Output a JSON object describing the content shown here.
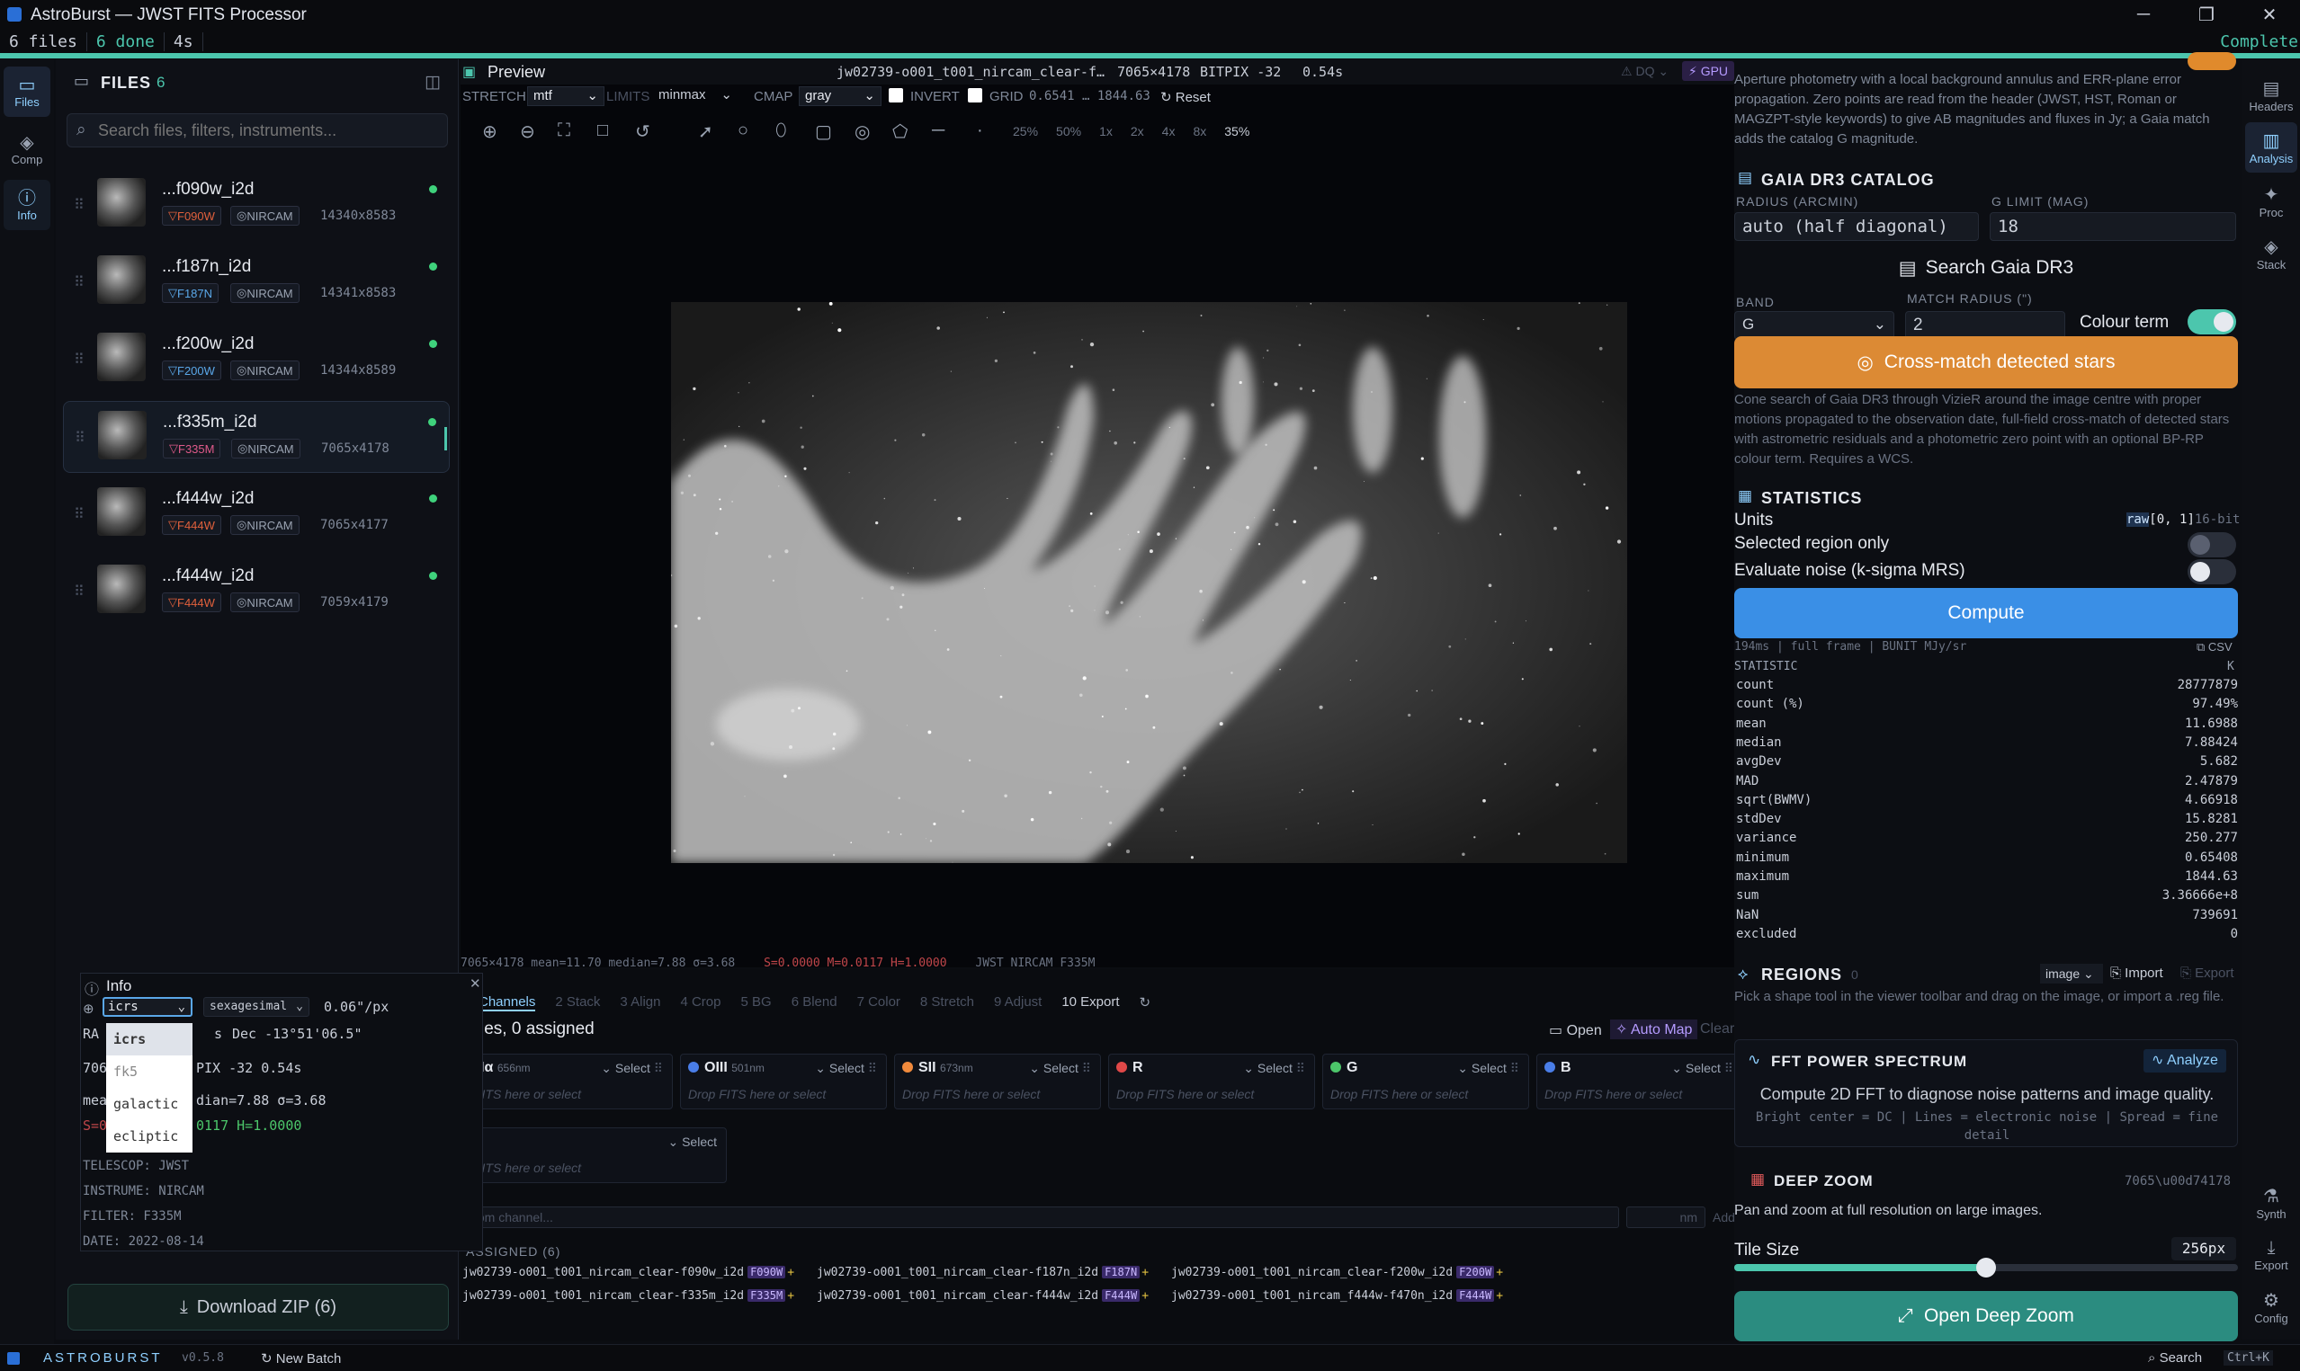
{
  "window": {
    "title": "AstroBurst — JWST FITS Processor",
    "minimize": "─",
    "maximize": "❐",
    "close": "✕"
  },
  "status": {
    "files": "6 files",
    "done": "6 done",
    "time": "4s",
    "state": "Complete"
  },
  "left_rail": [
    {
      "label": "Files",
      "icon": "folder-icon"
    },
    {
      "label": "Comp",
      "icon": "layers-icon"
    },
    {
      "label": "Info",
      "icon": "info-icon"
    }
  ],
  "files_panel": {
    "title": "FILES",
    "count": "6",
    "search_placeholder": "Search files, filters, instruments...",
    "items": [
      {
        "name": "...f090w_i2d",
        "filter": "F090W",
        "instrument": "NIRCAM",
        "dims": "14340x8583",
        "filter_color": "#e0603c"
      },
      {
        "name": "...f187n_i2d",
        "filter": "F187N",
        "instrument": "NIRCAM",
        "dims": "14341x8583",
        "filter_color": "#5aa7e8"
      },
      {
        "name": "...f200w_i2d",
        "filter": "F200W",
        "instrument": "NIRCAM",
        "dims": "14344x8589",
        "filter_color": "#5aa7e8"
      },
      {
        "name": "...f335m_i2d",
        "filter": "F335M",
        "instrument": "NIRCAM",
        "dims": "7065x4178",
        "filter_color": "#e05a8a"
      },
      {
        "name": "...f444w_i2d",
        "filter": "F444W",
        "instrument": "NIRCAM",
        "dims": "7065x4177",
        "filter_color": "#e0603c"
      },
      {
        "name": "...f444w_i2d",
        "filter": "F444W",
        "instrument": "NIRCAM",
        "dims": "7059x4179",
        "filter_color": "#e0603c"
      }
    ],
    "download": "Download ZIP (6)"
  },
  "preview": {
    "title": "Preview",
    "filename": "jw02739-o001_t001_nircam_clear-f…",
    "dims": "7065×4178",
    "bitpix": "BITPIX -32",
    "time": "0.54s",
    "dq": "DQ",
    "gpu": "GPU",
    "stretch_label": "STRETCH",
    "stretch": "mtf",
    "limits_label": "LIMITS",
    "limits": "minmax",
    "cmap_label": "CMAP",
    "cmap": "gray",
    "invert": "INVERT",
    "grid": "GRID",
    "range": "0.6541 … 1844.63",
    "reset": "Reset",
    "zooms": [
      "25%",
      "50%",
      "1x",
      "2x",
      "4x",
      "8x",
      "35%"
    ],
    "footer": "7065×4178  mean=11.70 median=7.88 σ=3.68",
    "footer_stf": "S=0.0000 M=0.0117 H=1.0000",
    "footer_inst": "JWST NIRCAM F335M"
  },
  "info_panel": {
    "title": "Info",
    "frame": "icrs",
    "format": "sexagesimal",
    "scale": "0.06\"/px",
    "ra_label": "RA",
    "ra_tail": "s",
    "dec": "Dec -13°51'06.5\"",
    "row2_a": "706",
    "row2_b": "PIX -32  0.54s",
    "row3_a": "mea",
    "row3_b": "dian=7.88  σ=3.68",
    "row4_a": "S=0",
    "row4_b": "0117  H=1.0000",
    "telescope": "TELESCOP: JWST",
    "instrument": "INSTRUME: NIRCAM",
    "filter": "FILTER: F335M",
    "date": "DATE: 2022-08-14",
    "menu": [
      "icrs",
      "fk5",
      "galactic",
      "ecliptic"
    ]
  },
  "pipeline_tabs": [
    "Channels",
    "2 Stack",
    "3 Align",
    "4 Crop",
    "5 BG",
    "6 Blend",
    "7 Color",
    "8 Stretch",
    "9 Adjust",
    "10 Export"
  ],
  "channels": {
    "assigned": "les, 0 assigned",
    "open": "Open",
    "automap": "Auto Map",
    "clear": "Clear",
    "select": "Select",
    "drop": "Drop FITS here or select",
    "drop_cut": "FITS here or select",
    "items": [
      {
        "name": "Hα",
        "nm": "656nm",
        "color": ""
      },
      {
        "name": "OIII",
        "nm": "501nm",
        "color": "#4a7ee8"
      },
      {
        "name": "SII",
        "nm": "673nm",
        "color": "#f08a3c"
      },
      {
        "name": "R",
        "nm": "",
        "color": "#e04848"
      },
      {
        "name": "G",
        "nm": "",
        "color": "#4cc66a"
      },
      {
        "name": "B",
        "nm": "",
        "color": "#4a7ee8"
      }
    ],
    "custom_placeholder": "tom channel...",
    "nm_placeholder": "nm",
    "add": "Add",
    "unassigned_title": "ASSIGNED (6)",
    "unassigned": [
      {
        "name": "jw02739-o001_t001_nircam_clear-f090w_i2d",
        "chip": "F090W"
      },
      {
        "name": "jw02739-o001_t001_nircam_clear-f187n_i2d",
        "chip": "F187N"
      },
      {
        "name": "jw02739-o001_t001_nircam_clear-f200w_i2d",
        "chip": "F200W"
      },
      {
        "name": "jw02739-o001_t001_nircam_clear-f335m_i2d",
        "chip": "F335M"
      },
      {
        "name": "jw02739-o001_t001_nircam_clear-f444w_i2d",
        "chip": "F444W"
      },
      {
        "name": "jw02739-o001_t001_nircam_f444w-f470n_i2d",
        "chip": "F444W"
      }
    ]
  },
  "photometry": {
    "desc": "Aperture photometry with a local background annulus and ERR-plane error propagation. Zero points are read from the header (JWST, HST, Roman or MAGZPT-style keywords) to give AB magnitudes and fluxes in Jy; a Gaia match adds the catalog G magnitude."
  },
  "gaia": {
    "title": "GAIA DR3 CATALOG",
    "radius_label": "RADIUS (ARCMIN)",
    "radius": "auto (half diagonal)",
    "glimit_label": "G LIMIT (MAG)",
    "glimit": "18",
    "search": "Search Gaia DR3",
    "band_label": "BAND",
    "band": "G",
    "match_label": "MATCH RADIUS (\")",
    "match": "2",
    "colour_term": "Colour term",
    "crossmatch": "Cross-match detected stars",
    "desc": "Cone search of Gaia DR3 through VizieR around the image centre with proper motions propagated to the observation date, full-field cross-match of detected stars with astrometric residuals and a photometric zero point with an optional BP-RP colour term. Requires a WCS."
  },
  "statistics": {
    "title": "STATISTICS",
    "units": "Units",
    "units_val": "raw",
    "units_range": "[0, 1]",
    "units_bit": "16-bit",
    "region_only": "Selected region only",
    "noise": "Evaluate noise (k-sigma MRS)",
    "compute": "Compute",
    "meta": "194ms | full frame | BUNIT MJy/sr",
    "csv": "CSV",
    "header_left": "STATISTIC",
    "header_right": "K",
    "rows": [
      [
        "count",
        "28777879"
      ],
      [
        "count (%)",
        "97.49%"
      ],
      [
        "mean",
        "11.6988"
      ],
      [
        "median",
        "7.88424"
      ],
      [
        "avgDev",
        "5.682"
      ],
      [
        "MAD",
        "2.47879"
      ],
      [
        "sqrt(BWMV)",
        "4.66918"
      ],
      [
        "stdDev",
        "15.8281"
      ],
      [
        "variance",
        "250.277"
      ],
      [
        "minimum",
        "0.65408"
      ],
      [
        "maximum",
        "1844.63"
      ],
      [
        "sum",
        "3.36666e+8"
      ],
      [
        "NaN",
        "739691"
      ],
      [
        "excluded",
        "0"
      ]
    ]
  },
  "regions": {
    "title": "REGIONS",
    "count": "0",
    "coord": "image",
    "import": "Import",
    "export": "Export",
    "desc": "Pick a shape tool in the viewer toolbar and drag on the image, or import a .reg file."
  },
  "fft": {
    "title": "FFT POWER SPECTRUM",
    "analyze": "Analyze",
    "desc": "Compute 2D FFT to diagnose noise patterns and image quality.",
    "hint": "Bright center = DC | Lines = electronic noise | Spread = fine detail"
  },
  "deepzoom": {
    "title": "DEEP ZOOM",
    "dims": "7065\\u00d74178",
    "desc": "Pan and zoom at full resolution on large images.",
    "tile_label": "Tile Size",
    "tile": "256px",
    "tile_level": 0.5,
    "open": "Open Deep Zoom"
  },
  "right_rail": [
    {
      "label": "Headers",
      "icon": "document-icon"
    },
    {
      "label": "Analysis",
      "icon": "bar-chart-icon"
    },
    {
      "label": "Proc",
      "icon": "sparkle-icon"
    },
    {
      "label": "Stack",
      "icon": "layers-icon"
    },
    {
      "label": "Synth",
      "icon": "flask-icon"
    },
    {
      "label": "Export",
      "icon": "download-icon"
    },
    {
      "label": "Config",
      "icon": "gear-icon"
    }
  ],
  "footer": {
    "brand": "ASTROBURST",
    "version": "v0.5.8",
    "new_batch": "New Batch",
    "search": "Search",
    "shortcut": "Ctrl+K"
  }
}
